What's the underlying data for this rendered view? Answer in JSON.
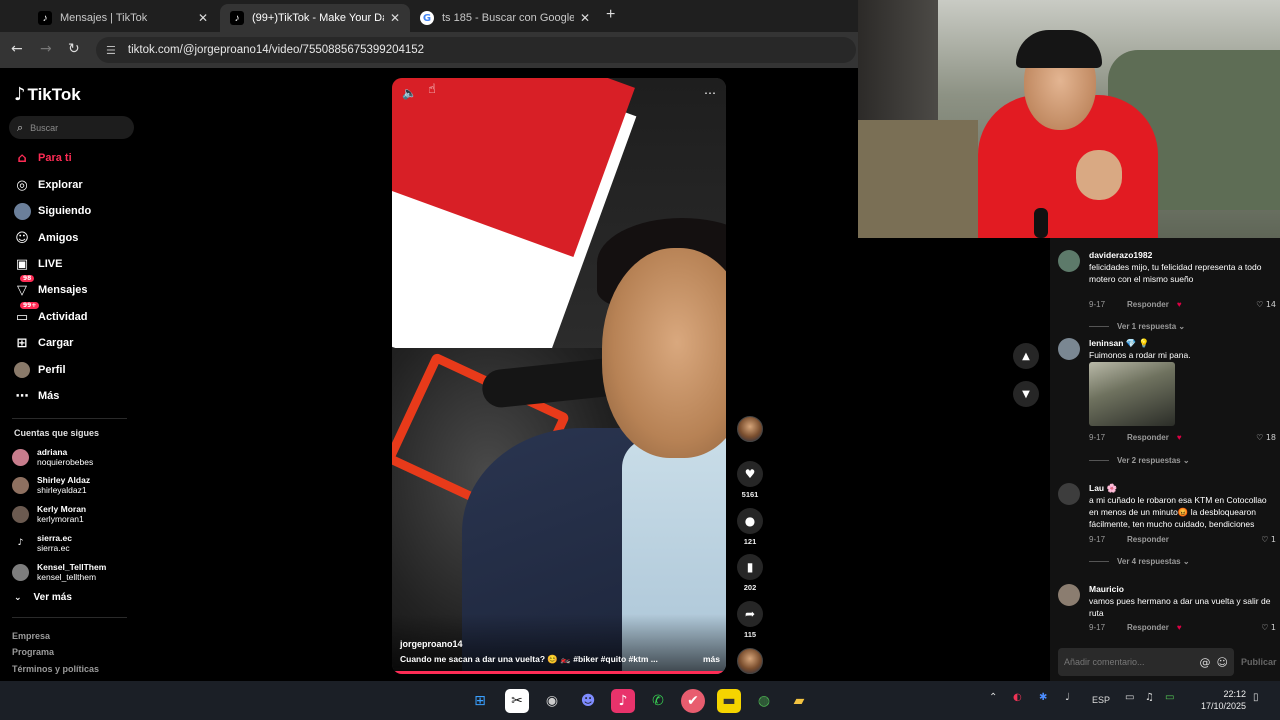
{
  "browser": {
    "tabs": [
      {
        "title": "Mensajes | TikTok",
        "active": false
      },
      {
        "title": "(99+)TikTok - Make Your Day",
        "active": true
      },
      {
        "title": "ts 185 - Buscar con Google",
        "active": false
      }
    ],
    "url": "tiktok.com/@jorgeproano14/video/7550885675399204152"
  },
  "sidebar": {
    "logo": "TikTok",
    "search_placeholder": "Buscar",
    "nav": [
      {
        "label": "Para ti",
        "icon": "home-icon",
        "active": true
      },
      {
        "label": "Explorar",
        "icon": "compass-icon"
      },
      {
        "label": "Siguiendo",
        "icon": "following-icon"
      },
      {
        "label": "Amigos",
        "icon": "friends-icon"
      },
      {
        "label": "LIVE",
        "icon": "live-icon"
      },
      {
        "label": "Mensajes",
        "icon": "messages-icon",
        "badge": "98"
      },
      {
        "label": "Actividad",
        "icon": "activity-icon",
        "badge": "99+"
      },
      {
        "label": "Cargar",
        "icon": "upload-icon"
      },
      {
        "label": "Perfil",
        "icon": "profile-avatar"
      },
      {
        "label": "Más",
        "icon": "more-icon"
      }
    ],
    "following_title": "Cuentas que sigues",
    "following": [
      {
        "name": "adriana",
        "handle": "noquierobebes"
      },
      {
        "name": "Shirley Aldaz",
        "handle": "shirleyaldaz1"
      },
      {
        "name": "Kerly Moran",
        "handle": "kerlymoran1"
      },
      {
        "name": "sierra.ec",
        "handle": "sierra.ec"
      },
      {
        "name": "Kensel_TellThem",
        "handle": "kensel_tellthem"
      }
    ],
    "see_more": "Ver más",
    "footer": [
      "Empresa",
      "Programa",
      "Términos y políticas"
    ]
  },
  "video": {
    "username": "jorgeproano14",
    "caption": "Cuando me sacan a dar una vuelta? 😊 🏍️ #biker #quito #ktm ...",
    "more": "más",
    "likes": "5161",
    "comments": "121",
    "saves": "202",
    "shares": "115"
  },
  "comments": [
    {
      "user": "daviderazo1982",
      "text": "felicidades mijo, tu felicidad representa a todo motero con el mismo sueño",
      "date": "9-17",
      "reply": "Responder",
      "likes": "14",
      "replies": "Ver 1 respuesta"
    },
    {
      "user": "leninsan 💎 💡",
      "text": "Fuimonos a rodar mi pana.",
      "date": "9-17",
      "reply": "Responder",
      "likes": "18",
      "replies": "Ver 2 respuestas"
    },
    {
      "user": "Lau 🌸",
      "text": "a mi cuñado le robaron esa KTM en Cotocollao en menos de un minuto😡 la desbloquearon fácilmente, ten mucho cuidado, bendiciones",
      "date": "9-17",
      "reply": "Responder",
      "likes": "1",
      "replies": "Ver 4 respuestas"
    },
    {
      "user": "Mauricio",
      "text": "vamos pues hermano a dar una vuelta y salir de ruta",
      "date": "9-17",
      "reply": "Responder",
      "likes": "1"
    }
  ],
  "comment_input": {
    "placeholder": "Añadir comentario...",
    "publish": "Publicar"
  },
  "taskbar": {
    "lang": "ESP",
    "time": "22:12",
    "date": "17/10/2025"
  },
  "colors": {
    "accent": "#fe2c55",
    "background": "#000000",
    "panel": "#121212"
  }
}
